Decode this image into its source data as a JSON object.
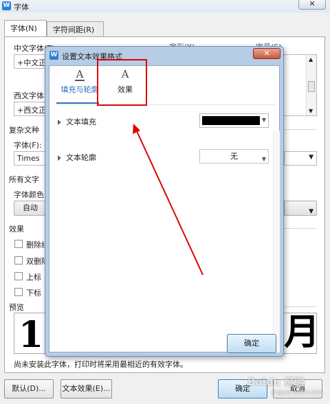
{
  "outer_dialog": {
    "title": "字体",
    "app_icon": "W",
    "close_glyph": "✕",
    "tabs": [
      {
        "label": "字体(N)",
        "active": true
      },
      {
        "label": "字符间距(R)",
        "active": false
      }
    ],
    "cn_font_label": "中文字体(T)",
    "cn_font_value": "+中文正文",
    "latin_font_label": "西文字体",
    "latin_font_value": "+西文正文",
    "style_header_partial": "字形(Y)",
    "size_header_partial": "字号(S)",
    "complex_section": "复杂文种",
    "font_label": "字体(F):",
    "font_value": "Times",
    "all_text_section": "所有文字",
    "font_color_label": "字体颜色",
    "font_color_value": "自动",
    "effects_section": "效果",
    "effects": [
      "删除线",
      "双删除线",
      "上标",
      "下标"
    ],
    "preview_section": "预览",
    "preview_left_glyph": "1",
    "preview_right_glyph": "月",
    "footnote": "尚未安装此字体，打印时将采用最相近的有效字体。",
    "buttons": {
      "default": "默认(D)...",
      "text_effect": "文本效果(E)...",
      "ok": "确定",
      "cancel": "取消"
    }
  },
  "inner_dialog": {
    "title": "设置文本效果格式",
    "app_icon": "W",
    "close_glyph": "✕",
    "tabs": [
      {
        "label": "填充与轮廓",
        "icon": "A",
        "active": true
      },
      {
        "label": "效果",
        "icon": "A",
        "active": false
      }
    ],
    "sections": [
      {
        "label": "文本填充",
        "control": "color",
        "color": "#000000"
      },
      {
        "label": "文本轮廓",
        "control": "select",
        "value": "无"
      }
    ],
    "ok_label": "确定"
  },
  "annotation": {
    "color": "#e00000"
  },
  "watermark": {
    "text": "Baidu 经验",
    "sub": "jingyan.baidu.com"
  }
}
